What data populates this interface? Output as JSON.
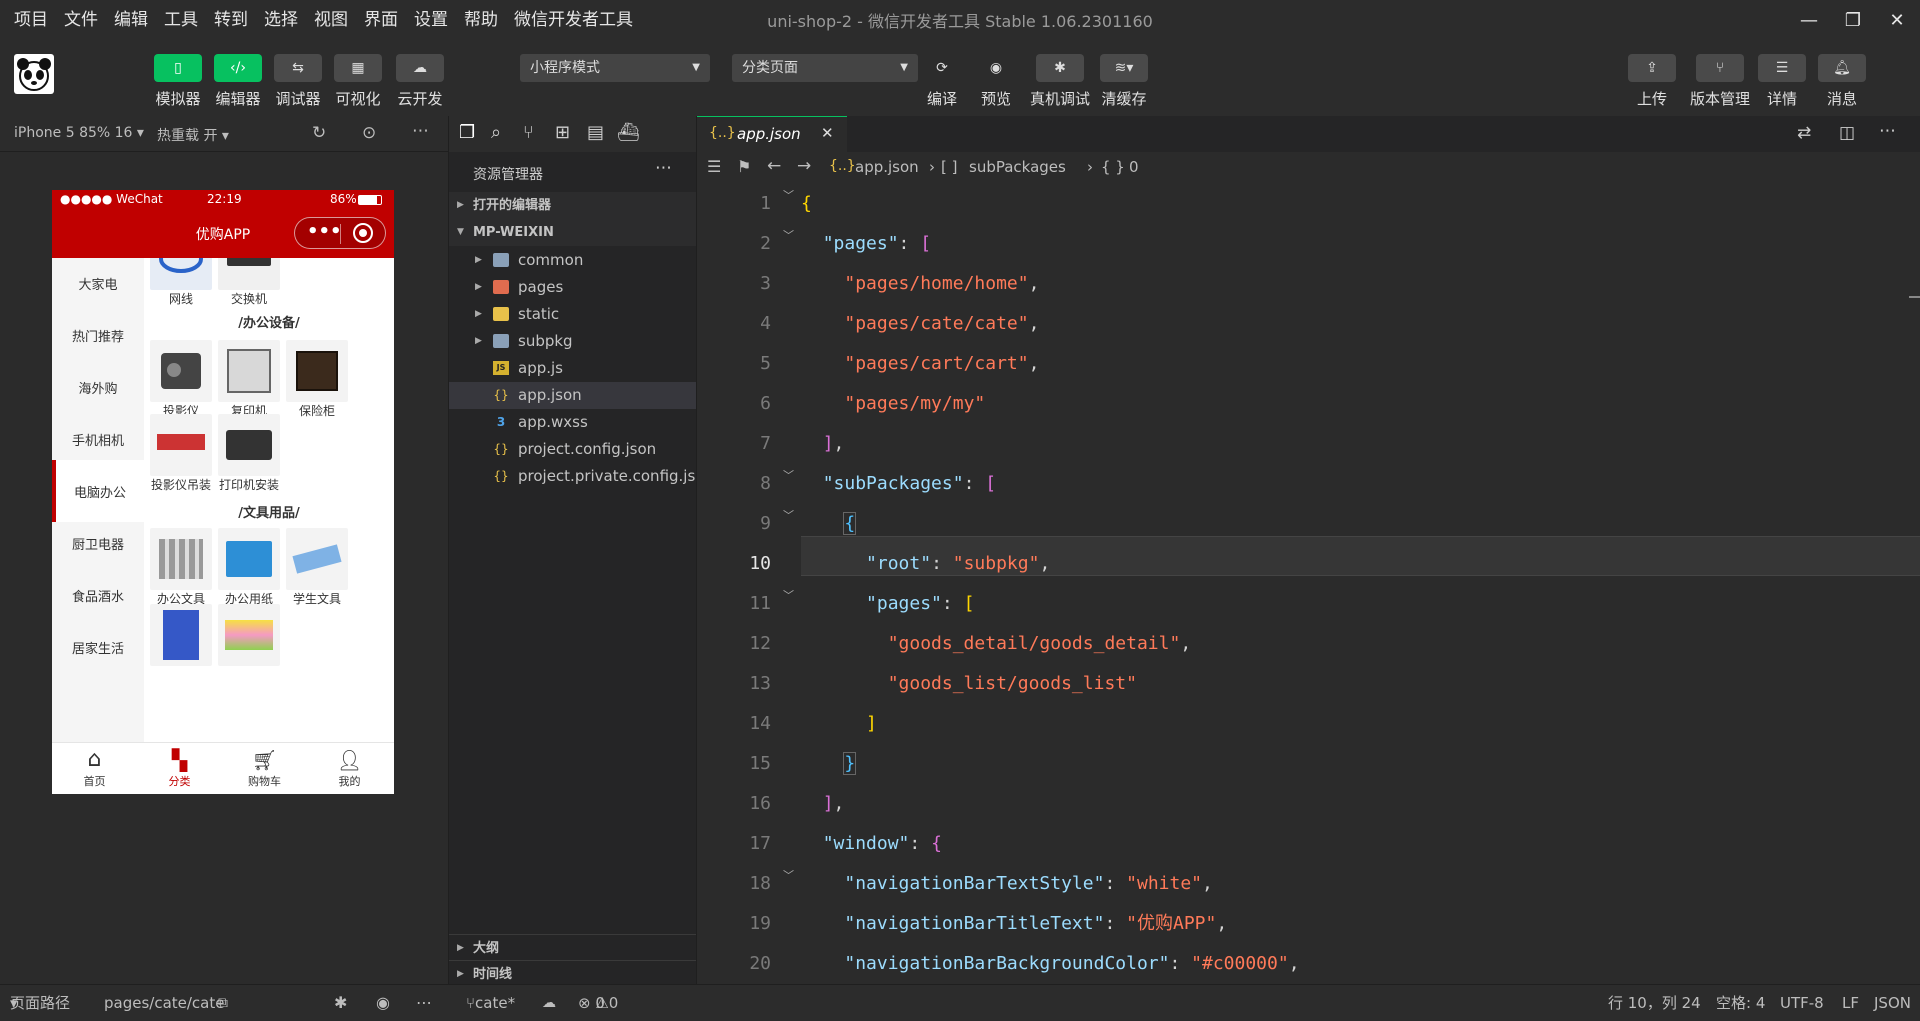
{
  "menubar": {
    "items": [
      "项目",
      "文件",
      "编辑",
      "工具",
      "转到",
      "选择",
      "视图",
      "界面",
      "设置",
      "帮助",
      "微信开发者工具"
    ],
    "title": "uni-shop-2 - 微信开发者工具 Stable 1.06.2301160"
  },
  "toolbar": {
    "simulator": "模拟器",
    "editor": "编辑器",
    "debugger": "调试器",
    "visual": "可视化",
    "cloud": "云开发",
    "mode_select": "小程序模式",
    "page_select": "分类页面",
    "compile": "编译",
    "preview": "预览",
    "realdebug": "真机调试",
    "clearcache": "清缓存",
    "upload": "上传",
    "version": "版本管理",
    "details": "详情",
    "messages": "消息",
    "brand_color": "#07c160"
  },
  "simbar": {
    "device": "iPhone 5 85% 16",
    "hotreload": "热重载 开"
  },
  "phone": {
    "status_left": "●●●●● WeChat",
    "time": "22:19",
    "battery": "86%",
    "nav_title": "优购APP",
    "nav_color": "#c00000",
    "categories": [
      "大家电",
      "热门推荐",
      "海外购",
      "手机相机",
      "电脑办公",
      "厨卫电器",
      "食品酒水",
      "居家生活"
    ],
    "active_category": "电脑办公",
    "top_products": [
      "网线",
      "交换机"
    ],
    "sections": [
      {
        "title": "/办公设备/",
        "products": [
          "投影仪",
          "复印机",
          "保险柜",
          "投影仪吊装",
          "打印机安装"
        ]
      },
      {
        "title": "/文具用品/",
        "products": [
          "办公文具",
          "办公用纸",
          "学生文具"
        ]
      }
    ],
    "tabs": [
      "首页",
      "分类",
      "购物车",
      "我的"
    ],
    "active_tab": "分类"
  },
  "explorer": {
    "title": "资源管理器",
    "open_editors": "打开的编辑器",
    "root": "MP-WEIXIN",
    "folders": [
      "common",
      "pages",
      "static",
      "subpkg"
    ],
    "files": [
      "app.js",
      "app.json",
      "app.wxss",
      "project.config.json",
      "project.private.config.js..."
    ],
    "outline": "大纲",
    "timeline": "时间线"
  },
  "editor": {
    "tab_name": "app.json",
    "breadcrumb": {
      "file": "app.json",
      "key1": "subPackages",
      "key2": "0"
    },
    "lines": [
      {
        "n": "1"
      },
      {
        "n": "2"
      },
      {
        "n": "3"
      },
      {
        "n": "4"
      },
      {
        "n": "5"
      },
      {
        "n": "6"
      },
      {
        "n": "7"
      },
      {
        "n": "8"
      },
      {
        "n": "9"
      },
      {
        "n": "10"
      },
      {
        "n": "11"
      },
      {
        "n": "12"
      },
      {
        "n": "13"
      },
      {
        "n": "14"
      },
      {
        "n": "15"
      },
      {
        "n": "16"
      },
      {
        "n": "17"
      },
      {
        "n": "18"
      },
      {
        "n": "19"
      },
      {
        "n": "20"
      }
    ],
    "code": {
      "pages_key": "\"pages\"",
      "p1": "\"pages/home/home\"",
      "p2": "\"pages/cate/cate\"",
      "p3": "\"pages/cart/cart\"",
      "p4": "\"pages/my/my\"",
      "subpackages_key": "\"subPackages\"",
      "root_key": "\"root\"",
      "root_val": "\"subpkg\"",
      "sub_pages_key": "\"pages\"",
      "s1": "\"goods_detail/goods_detail\"",
      "s2": "\"goods_list/goods_list\"",
      "window_key": "\"window\"",
      "w1k": "\"navigationBarTextStyle\"",
      "w1v": "\"white\"",
      "w2k": "\"navigationBarTitleText\"",
      "w2v": "\"优购APP\"",
      "w3k": "\"navigationBarBackgroundColor\"",
      "w3v": "\"#c00000\""
    }
  },
  "statusbar": {
    "path_label": "页面路径",
    "path": "pages/cate/cate",
    "branch": "cate*",
    "errors": "0",
    "warnings": "0",
    "position": "行 10，列 24",
    "spaces": "空格: 4",
    "encoding": "UTF-8",
    "eol": "LF",
    "lang": "JSON"
  }
}
